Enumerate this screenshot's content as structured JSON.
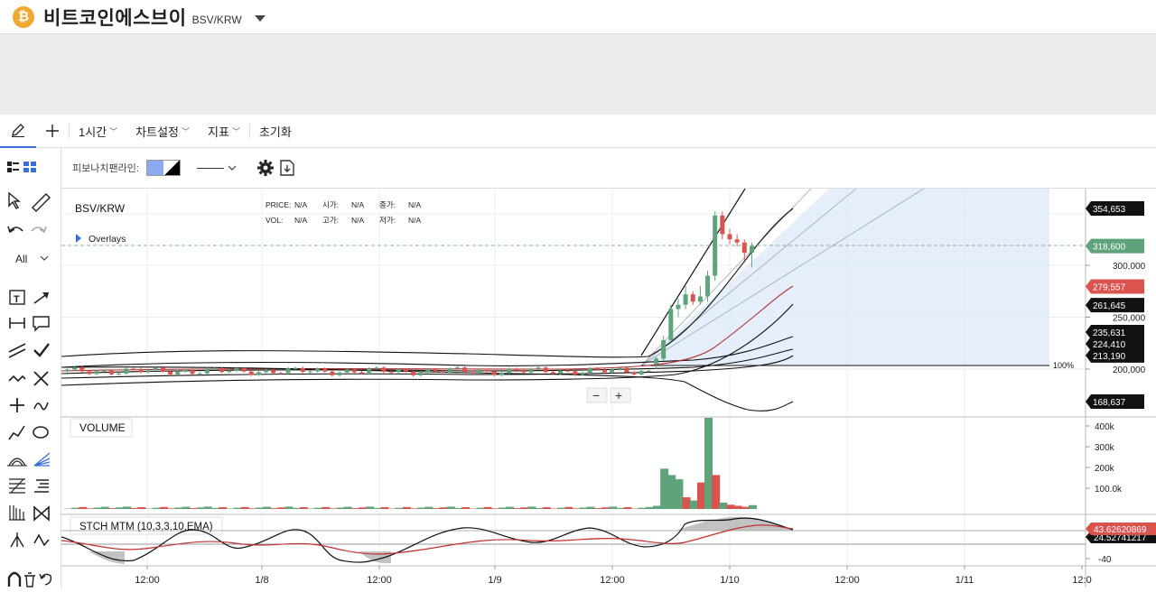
{
  "header": {
    "coin_symbol": "₿",
    "coin_name": "비트코인에스브이",
    "pair": "BSV/KRW"
  },
  "toolbar": {
    "interval": "1시간",
    "chart_settings": "차트설정",
    "indicators": "지표",
    "reset": "초기화"
  },
  "left_tools": {
    "filter_label": "All",
    "icons": [
      "list-view-icon",
      "grid-view-icon",
      "cursor-icon",
      "ruler-icon",
      "undo-icon",
      "redo-icon",
      "text-icon",
      "arrow-icon",
      "range-icon",
      "callout-icon",
      "parallel-lines-icon",
      "check-icon",
      "wave-icon",
      "cross-icon",
      "plus-cross-icon",
      "curve-icon",
      "polyline-icon",
      "ellipse-icon",
      "fib-arc-icon",
      "fib-fan-icon",
      "fib-retracement-icon",
      "fib-levels-icon",
      "fib-timezone-icon",
      "hourglass-icon",
      "pitchfork-icon",
      "zigzag-icon",
      "magnet-icon",
      "trash-icon",
      "rotate-icon"
    ]
  },
  "subbar": {
    "fib_label": "피보나치팬라인:",
    "fill_color": "#8aa9ef",
    "icons": [
      "gear-icon",
      "download-icon"
    ]
  },
  "legend": {
    "symbol": "BSV/KRW",
    "overlays": "Overlays",
    "price_label": "PRICE:",
    "price_val": "N/A",
    "open_label": "시가:",
    "open_val": "N/A",
    "close_label": "종가:",
    "close_val": "N/A",
    "vol_label": "VOL:",
    "vol_val": "N/A",
    "high_label": "고가:",
    "high_val": "N/A",
    "low_label": "저가:",
    "low_val": "N/A"
  },
  "zoom": {
    "minus": "−",
    "plus": "+"
  },
  "panes": {
    "volume_title": "VOLUME",
    "stoch_title": "STCH MTM (10,3,3,10,EMA)"
  },
  "chart_data": {
    "type": "candlestick",
    "price_axis_ticks": [
      "300,000",
      "250,000",
      "200,000"
    ],
    "price_tags": [
      {
        "value": "354,653",
        "color": "#111111"
      },
      {
        "value": "318,600",
        "color": "#5fa37a"
      },
      {
        "value": "279,557",
        "color": "#d9534f"
      },
      {
        "value": "261,645",
        "color": "#111111"
      },
      {
        "value": "235,631",
        "color": "#111111"
      },
      {
        "value": "224,410",
        "color": "#111111"
      },
      {
        "value": "213,190",
        "color": "#111111"
      },
      {
        "value": "168,637",
        "color": "#111111"
      }
    ],
    "fib_level_label": "100%",
    "volume_axis_ticks": [
      "400k",
      "300k",
      "200k",
      "100.0k"
    ],
    "stoch_tags": [
      {
        "value": "43.62620869",
        "color": "#d9534f"
      },
      {
        "value": "24.52741217",
        "color": "#111111"
      }
    ],
    "stoch_axis_ticks": [
      "-40"
    ],
    "time_labels": [
      "12:00",
      "1/8",
      "12:00",
      "1/9",
      "12:00",
      "1/10",
      "12:00",
      "1/11",
      "12:0"
    ],
    "candles_recent": [
      {
        "o": 205000,
        "h": 212000,
        "l": 200000,
        "c": 210000
      },
      {
        "o": 210000,
        "h": 232000,
        "l": 208000,
        "c": 228000
      },
      {
        "o": 228000,
        "h": 262000,
        "l": 226000,
        "c": 258000
      },
      {
        "o": 258000,
        "h": 268000,
        "l": 250000,
        "c": 262000
      },
      {
        "o": 262000,
        "h": 280000,
        "l": 258000,
        "c": 272000
      },
      {
        "o": 272000,
        "h": 275000,
        "l": 262000,
        "c": 265000
      },
      {
        "o": 265000,
        "h": 280000,
        "l": 262000,
        "c": 270000
      },
      {
        "o": 270000,
        "h": 295000,
        "l": 265000,
        "c": 290000
      },
      {
        "o": 290000,
        "h": 352000,
        "l": 285000,
        "c": 348000
      },
      {
        "o": 348000,
        "h": 352000,
        "l": 325000,
        "c": 330000
      },
      {
        "o": 330000,
        "h": 335000,
        "l": 320000,
        "c": 325000
      },
      {
        "o": 325000,
        "h": 330000,
        "l": 318000,
        "c": 322000
      },
      {
        "o": 322000,
        "h": 325000,
        "l": 305000,
        "c": 312000
      },
      {
        "o": 312000,
        "h": 322000,
        "l": 298000,
        "c": 318600
      }
    ],
    "volume_recent": [
      {
        "v": 15000,
        "up": true
      },
      {
        "v": 190000,
        "up": true
      },
      {
        "v": 160000,
        "up": true
      },
      {
        "v": 140000,
        "up": true
      },
      {
        "v": 55000,
        "up": false
      },
      {
        "v": 40000,
        "up": true
      },
      {
        "v": 125000,
        "up": false
      },
      {
        "v": 430000,
        "up": true
      },
      {
        "v": 160000,
        "up": false
      },
      {
        "v": 30000,
        "up": true
      },
      {
        "v": 20000,
        "up": false
      },
      {
        "v": 15000,
        "up": false
      },
      {
        "v": 10000,
        "up": false
      },
      {
        "v": 18000,
        "up": true
      }
    ],
    "colors": {
      "up": "#5fa37a",
      "down": "#d9534f",
      "fan_fill": "#dce8f8"
    }
  }
}
